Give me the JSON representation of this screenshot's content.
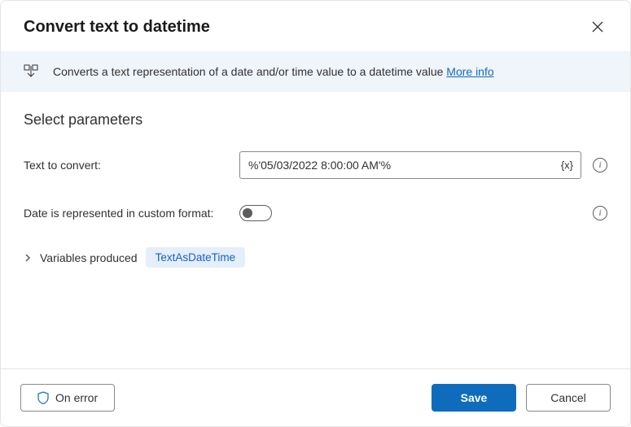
{
  "header": {
    "title": "Convert text to datetime"
  },
  "banner": {
    "text": "Converts a text representation of a date and/or time value to a datetime value ",
    "more_info": "More info"
  },
  "section": {
    "title": "Select parameters"
  },
  "fields": {
    "text_to_convert": {
      "label": "Text to convert:",
      "value": "%'05/03/2022 8:00:00 AM'%",
      "var_hint": "{x}"
    },
    "custom_format": {
      "label": "Date is represented in custom format:",
      "enabled": false
    }
  },
  "variables": {
    "label": "Variables produced",
    "items": [
      "TextAsDateTime"
    ]
  },
  "footer": {
    "on_error": "On error",
    "save": "Save",
    "cancel": "Cancel"
  }
}
